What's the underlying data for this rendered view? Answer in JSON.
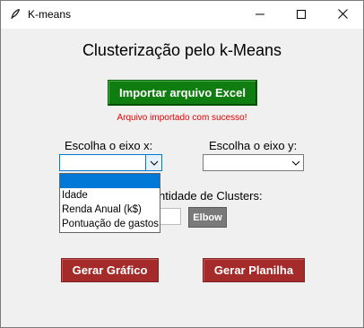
{
  "window": {
    "title": "K-means"
  },
  "main": {
    "heading": "Clusterização pelo k-Means",
    "import_button": "Importar arquivo Excel",
    "status_message": "Arquivo importado com sucesso!",
    "x_axis_label": "Escolha o eixo x:",
    "y_axis_label": "Escolha o eixo y:",
    "x_axis_value": "",
    "y_axis_value": "",
    "clusters_label": "ntidade de Clusters:",
    "clusters_value": "",
    "elbow_button": "Elbow",
    "graph_button": "Gerar Gráfico",
    "sheet_button": "Gerar Planilha"
  },
  "dropdown": {
    "options": [
      "",
      "Idade",
      "Renda Anual (k$)",
      "Pontuação de gastos"
    ],
    "selected_index": 0
  },
  "colors": {
    "import_button": "#0f7d0f",
    "status_text": "#e60000",
    "action_buttons": "#a52a2a",
    "elbow_button": "#7a7a7a",
    "selection": "#0078d7"
  },
  "icons": {
    "app": "feather-icon",
    "minimize": "minimize-icon",
    "maximize": "maximize-icon",
    "close": "close-icon",
    "dropdown": "chevron-down-icon"
  }
}
